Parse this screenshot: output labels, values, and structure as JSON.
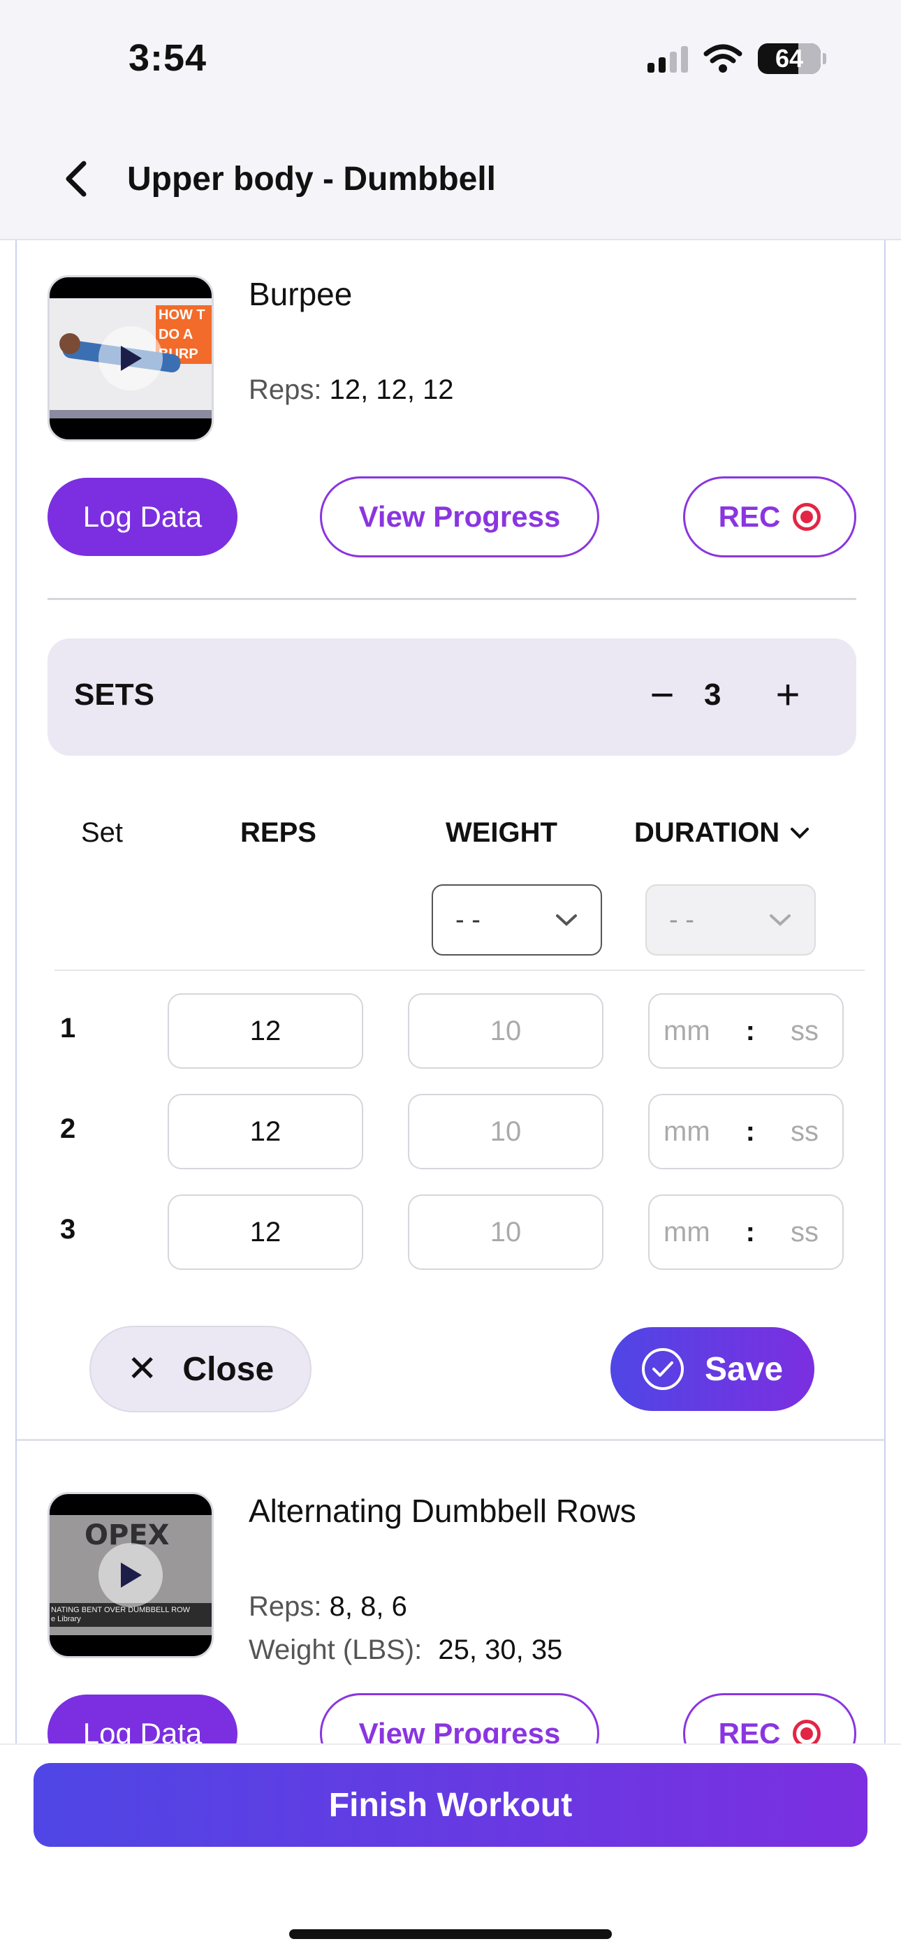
{
  "status_bar": {
    "time": "3:54",
    "battery": "64"
  },
  "header": {
    "title": "Upper body - Dumbbell"
  },
  "exercise1": {
    "name": "Burpee",
    "reps_label": "Reps:",
    "reps_value": "12, 12, 12",
    "thumb_text": [
      "HOW T",
      "DO A",
      "BURP"
    ],
    "log_label": "Log Data",
    "progress_label": "View Progress",
    "rec_label": "REC"
  },
  "sets": {
    "label": "SETS",
    "count": "3",
    "minus": "−",
    "plus": "+"
  },
  "table": {
    "col_set": "Set",
    "col_reps": "REPS",
    "col_weight": "WEIGHT",
    "col_duration": "DURATION",
    "weight_select": "- -",
    "duration_select": "- -",
    "rows": [
      {
        "num": "1",
        "reps": "12",
        "weight": "10",
        "mm": "mm",
        "ss": "ss"
      },
      {
        "num": "2",
        "reps": "12",
        "weight": "10",
        "mm": "mm",
        "ss": "ss"
      },
      {
        "num": "3",
        "reps": "12",
        "weight": "10",
        "mm": "mm",
        "ss": "ss"
      }
    ],
    "colon": ":"
  },
  "actions": {
    "close_label": "Close",
    "save_label": "Save"
  },
  "exercise2": {
    "name": "Alternating Dumbbell Rows",
    "reps_label": "Reps:",
    "reps_value": "8, 8, 6",
    "weight_label": "Weight (LBS):",
    "weight_value": "25, 30, 35",
    "thumb_logo": "OPEX",
    "thumb_caption": "NATING BENT OVER DUMBBELL ROW",
    "thumb_sub": "e Library",
    "log_label": "Log Data",
    "progress_label": "View Progress",
    "rec_label": "REC"
  },
  "footer": {
    "finish_label": "Finish Workout"
  },
  "colors": {
    "accent": "#7b2fe0",
    "rec": "#e32545",
    "gradient_start": "#4f46e5",
    "gradient_end": "#7c2fe0"
  }
}
